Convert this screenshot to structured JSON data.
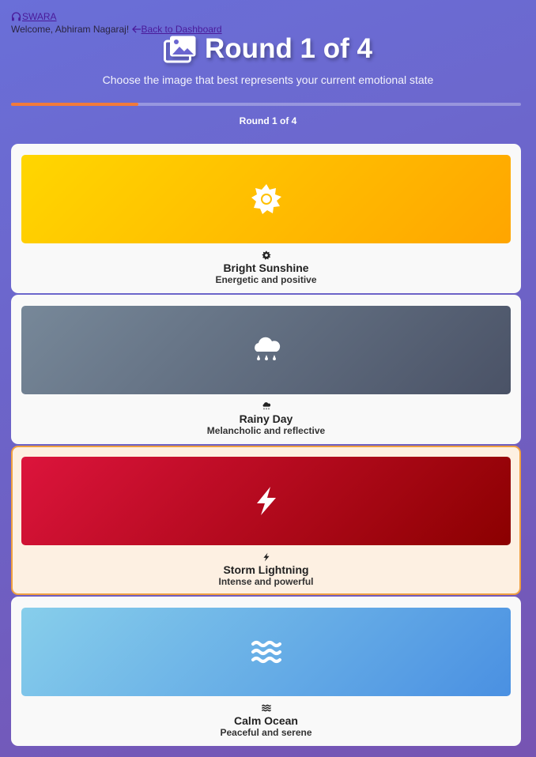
{
  "nav": {
    "brand": "SWARA",
    "welcome": "Welcome, Abhiram Nagaraj!",
    "back_label": "Back to Dashboard"
  },
  "header": {
    "title": "Round 1 of 4",
    "subtitle": "Choose the image that best represents your current emotional state",
    "icon": "images-icon"
  },
  "progress": {
    "fraction": 0.25,
    "label": "Round 1 of 4",
    "fill_color": "#f27a3a"
  },
  "options": [
    {
      "title": "Bright Sunshine",
      "description": "Energetic and positive",
      "icon": "sun-icon",
      "gradient": [
        "#ffd600",
        "#ffa500"
      ],
      "selected": false
    },
    {
      "title": "Rainy Day",
      "description": "Melancholic and reflective",
      "icon": "cloud-rain-icon",
      "gradient": [
        "#778899",
        "#4a5266"
      ],
      "selected": false
    },
    {
      "title": "Storm Lightning",
      "description": "Intense and powerful",
      "icon": "bolt-icon",
      "gradient": [
        "#dc143c",
        "#8b0000"
      ],
      "selected": true
    },
    {
      "title": "Calm Ocean",
      "description": "Peaceful and serene",
      "icon": "water-icon",
      "gradient": [
        "#87ceeb",
        "#4a90e2"
      ],
      "selected": false
    }
  ]
}
